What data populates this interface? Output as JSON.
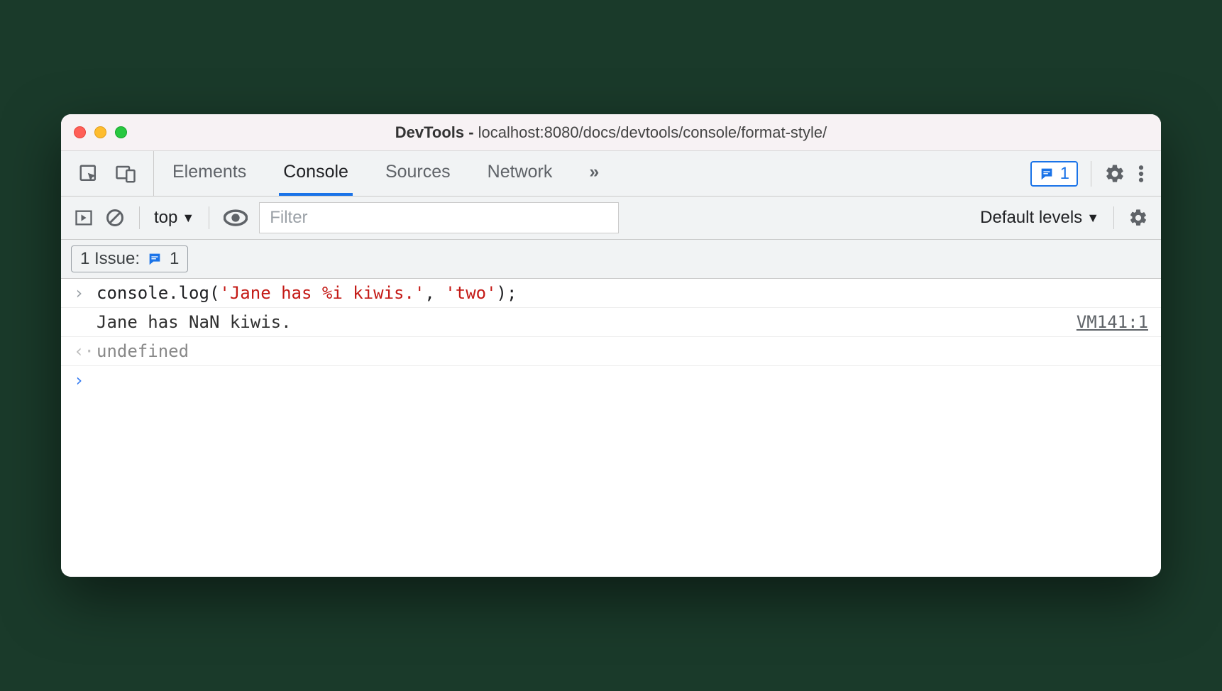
{
  "window": {
    "title_prefix": "DevTools - ",
    "title_path": "localhost:8080/docs/devtools/console/format-style/"
  },
  "tabs": {
    "elements": "Elements",
    "console": "Console",
    "sources": "Sources",
    "network": "Network",
    "overflow_glyph": "»"
  },
  "issue_badge": {
    "count": "1"
  },
  "toolbar": {
    "context": "top",
    "filter_placeholder": "Filter",
    "levels": "Default levels"
  },
  "issuebar": {
    "label": "1 Issue:",
    "count": "1"
  },
  "console": {
    "input_prefix": "console",
    "input_method": ".log(",
    "input_arg1": "'Jane has %i kiwis.'",
    "input_sep": ", ",
    "input_arg2": "'two'",
    "input_close": ");",
    "output_text": "Jane has NaN kiwis.",
    "source_link": "VM141:1",
    "return_text": "undefined"
  }
}
